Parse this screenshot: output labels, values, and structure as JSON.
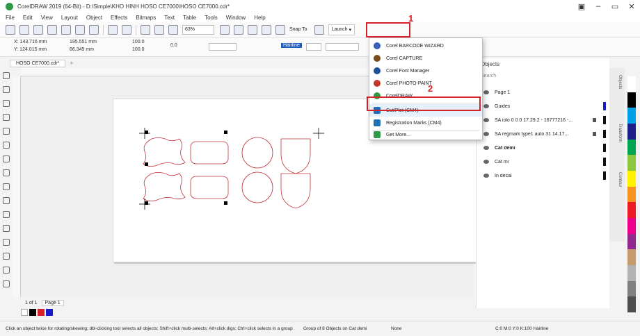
{
  "window": {
    "title": "CorelDRAW 2019 (64-Bit) - D:\\Simple\\KHO HINH HOSO CE7000\\HOSO CE7000.cdr*",
    "controls": [
      "▣",
      "–",
      "▭",
      "✕"
    ]
  },
  "menu": [
    "File",
    "Edit",
    "View",
    "Layout",
    "Object",
    "Effects",
    "Bitmaps",
    "Text",
    "Table",
    "Tools",
    "Window",
    "Help"
  ],
  "toolbar": {
    "zoom": "63%",
    "snap_label": "Snap To",
    "launch_label": "Launch"
  },
  "propbar": {
    "x": "X: 143.716 mm",
    "y": "Y: 124.015 mm",
    "w": "195.551 mm",
    "h": "86.349 mm",
    "sx": "100.0",
    "sy": "100.0",
    "angle": "0.0",
    "outline": "Hairline"
  },
  "doc_tab": "HOSO CE7000.cdr*",
  "page_nav": {
    "label": "Page 1",
    "current": "1 of 1"
  },
  "launch_menu": {
    "items": [
      {
        "label": "Corel BARCODE WIZARD",
        "icon": "barcode-icon",
        "color": "#3b5dbb"
      },
      {
        "label": "Corel CAPTURE",
        "icon": "capture-icon",
        "color": "#7a4d1a"
      },
      {
        "label": "Corel Font Manager",
        "icon": "font-manager-icon",
        "color": "#1d4f9a"
      },
      {
        "label": "Corel PHOTO-PAINT",
        "icon": "photo-paint-icon",
        "color": "#c23a2a"
      },
      {
        "label": "CorelDRAW",
        "icon": "coreldraw-icon",
        "color": "#2e9a47"
      },
      {
        "label": "Cut/Plot (CM4)",
        "icon": "cut-plot-icon",
        "color": "#1e6fb8"
      },
      {
        "label": "Registration Marks (CM4)",
        "icon": "registration-marks-icon",
        "color": "#1e6fb8"
      },
      {
        "label": "Get More...",
        "icon": "get-more-icon",
        "color": "#2e9a47"
      }
    ]
  },
  "annotations": {
    "step1": "1",
    "step2": "2"
  },
  "objects_panel": {
    "title": "Objects",
    "search": "Search",
    "page": "Page 1",
    "layers": [
      {
        "name": "Guides",
        "color": "#1a1acc"
      },
      {
        "name": "SA iolo 0 0 0 17.29.2 - 16777216 -...",
        "color": "#111"
      },
      {
        "name": "SA regmark type1 auto 31 14.17...",
        "color": "#111"
      },
      {
        "name": "Cat demi",
        "color": "#111"
      },
      {
        "name": "Cat mi",
        "color": "#111"
      },
      {
        "name": "In decal",
        "color": "#111"
      }
    ]
  },
  "side_tabs": [
    "Objects",
    "Transform",
    "Contour"
  ],
  "palette": [
    "#ffffff",
    "#000000",
    "#00a0e9",
    "#1d2088",
    "#00a651",
    "#8dc63f",
    "#fff200",
    "#f7941d",
    "#ed1c24",
    "#ec008c",
    "#92278f",
    "#c69c6d",
    "#b3b3b3",
    "#808080",
    "#4d4d4d"
  ],
  "status": {
    "hint": "Click an object twice for rotating/skewing; dbl-clicking tool selects all objects; Shift+click multi-selects; Alt+click digs; Ctrl+click selects in a group",
    "selection": "Group of 8 Objects on Cat demi",
    "fill": "None",
    "outline": "C:0 M:0 Y:0 K:100  Hairline"
  }
}
